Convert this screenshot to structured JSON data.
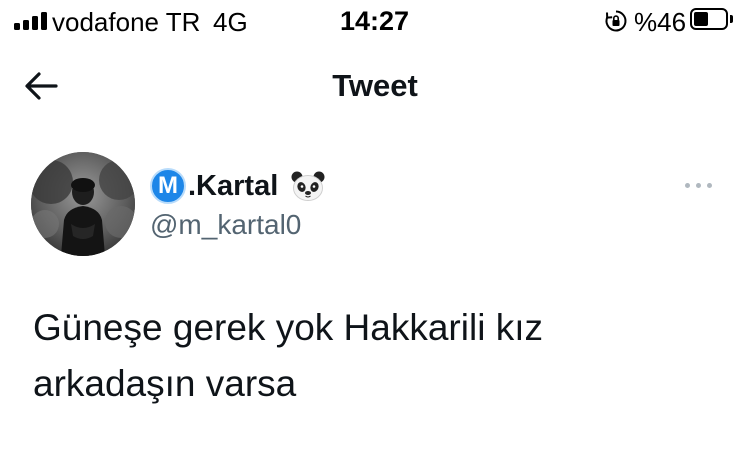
{
  "status_bar": {
    "carrier": "vodafone TR",
    "network": "4G",
    "time": "14:27",
    "battery_percent": "%46",
    "battery_level": 0.46,
    "icons": [
      "signal-bars-icon",
      "orientation-lock-icon",
      "battery-icon"
    ]
  },
  "nav": {
    "title": "Tweet",
    "back_icon": "arrow-left-icon"
  },
  "tweet": {
    "verified_badge_letter": "M",
    "display_name": ".Kartal",
    "name_emoji_icon": "panda-face-icon",
    "handle": "@m_kartal0",
    "more_icon": "more-horizontal-icon",
    "text_lines": [
      "Güneşe gerek yok Hakkarili kız",
      "arkadaşın varsa"
    ]
  },
  "colors": {
    "text_primary": "#0f1419",
    "text_secondary": "#536471",
    "badge_blue": "#1d86e8",
    "more_dots": "#b0b8bf"
  }
}
